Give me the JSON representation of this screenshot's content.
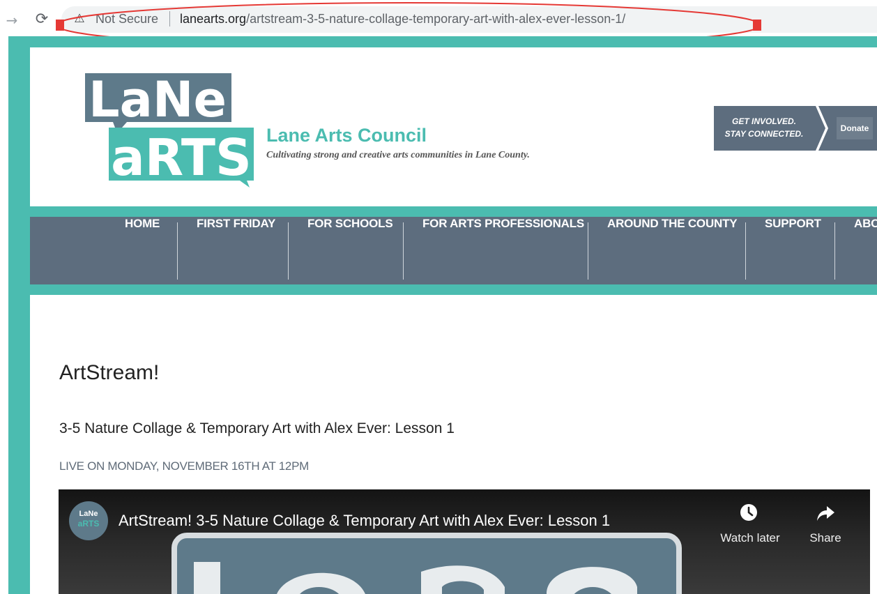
{
  "browser": {
    "forward_icon": "forward-arrow-icon",
    "reload_icon": "reload-icon",
    "warning_icon": "warning-triangle-icon",
    "security_label": "Not Secure",
    "url_host": "lanearts.org",
    "url_path": "/artstream-3-5-nature-collage-temporary-art-with-alex-ever-lesson-1/",
    "highlight_color": "#e53935"
  },
  "header": {
    "logo_line1": "LaNe",
    "logo_line2": "aRTS",
    "site_name": "Lane Arts Council",
    "tagline": "Cultivating strong and creative arts communities in Lane County.",
    "cta_line1": "GET INVOLVED.",
    "cta_line2": "STAY CONNECTED.",
    "donate_label": "Donate"
  },
  "nav": {
    "items": [
      {
        "label": "HOME"
      },
      {
        "label": "FIRST FRIDAY"
      },
      {
        "label": "FOR SCHOOLS"
      },
      {
        "label": "FOR ARTS PROFESSIONALS"
      },
      {
        "label": "AROUND THE COUNTY"
      },
      {
        "label": "SUPPORT"
      },
      {
        "label": "ABO"
      }
    ]
  },
  "content": {
    "title": "ArtStream!",
    "subtitle": "3-5 Nature Collage & Temporary Art with Alex Ever: Lesson 1",
    "live_notice": "LIVE ON MONDAY, NOVEMBER 16TH AT 12PM"
  },
  "video": {
    "channel_line1": "LaNe",
    "channel_line2": "aRTS",
    "title": "ArtStream! 3-5 Nature Collage & Temporary Art with Alex Ever: Lesson 1",
    "watch_later_label": "Watch later",
    "watch_later_icon": "clock-icon",
    "share_label": "Share",
    "share_icon": "share-arrow-icon"
  },
  "colors": {
    "teal": "#4bbcb0",
    "slate": "#5d6d7e",
    "logo_slate": "#5e7a8a"
  }
}
